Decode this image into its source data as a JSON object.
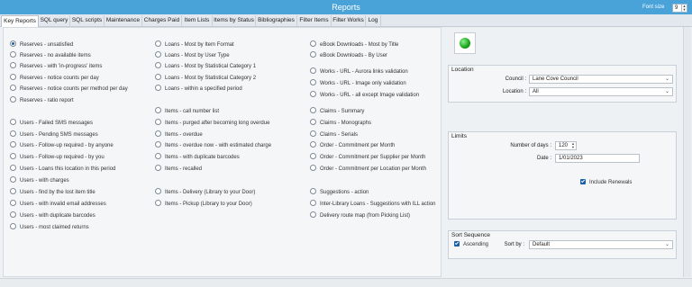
{
  "window": {
    "title": "Reports",
    "font_size_label": "Font size",
    "font_size_value": "9"
  },
  "tabs": [
    {
      "label": "Key Reports"
    },
    {
      "label": "SQL query"
    },
    {
      "label": "SQL scripts"
    },
    {
      "label": "Maintenance"
    },
    {
      "label": "Charges Paid"
    },
    {
      "label": "Item Lists"
    },
    {
      "label": "Items by Status"
    },
    {
      "label": "Bibliographies"
    },
    {
      "label": "Filter Items"
    },
    {
      "label": "Filter Works"
    },
    {
      "label": "Log"
    }
  ],
  "reports": {
    "col1": [
      "Reserves - unsatisfied",
      "Reserves - no available items",
      "Reserves - with 'in-progress' items",
      "Reserves - notice counts per day",
      "Reserves - notice counts per method per day",
      "Reserves - ratio report",
      "Users - Failed SMS messages",
      "Users - Pending SMS messages",
      "Users - Follow-up required - by anyone",
      "Users - Follow-up required - by you",
      "Users - Loans this location in this period",
      "Users - with charges",
      "Users - find by the lost item title",
      "Users - with invalid email addresses",
      "Users - with duplicate barcodes",
      "Users - most claimed returns"
    ],
    "col2": [
      "Loans - Most by Item Format",
      "Loans - Most by User Type",
      "Loans - Most by Statistical Category 1",
      "Loans - Most by Statistical Category 2",
      "Loans - within a specified period",
      "Items - call number list",
      "Items - purged after becoming long overdue",
      "Items - overdue",
      "Items - overdue now - with estimated charge",
      "Items - with duplicate barcodes",
      "Items - recalled",
      "Items - Delivery (Library to your Door)",
      "Items - Pickup (Library to your Door)"
    ],
    "col3": [
      "eBook Downloads - Most by Title",
      "eBook Downloads - By User",
      "Works - URL - Aurora links validation",
      "Works - URL - Image only validation",
      "Works - URL - all except Image validation",
      "Claims - Summary",
      "Claims - Monographs",
      "Claims - Serials",
      "Order - Commitment per Month",
      "Order - Commitment per Supplier per Month",
      "Order - Commitment per Location per Month",
      "Suggestions - action",
      "Inter-Library Loans - Suggestions with ILL action",
      "Delivery route map  (from Picking List)"
    ]
  },
  "location": {
    "title": "Location",
    "council_label": "Council :",
    "council_value": "Lane Cove Council",
    "location_label": "Location :",
    "location_value": "All"
  },
  "limits": {
    "title": "Limits",
    "days_label": "Number of days :",
    "days_value": "120",
    "date_label": "Date :",
    "date_value": "1/01/2023",
    "include_renewals_label": "Include Renewals"
  },
  "sort": {
    "title": "Sort Sequence",
    "ascending_label": "Ascending",
    "sortby_label": "Sort by :",
    "sortby_value": "Default"
  }
}
